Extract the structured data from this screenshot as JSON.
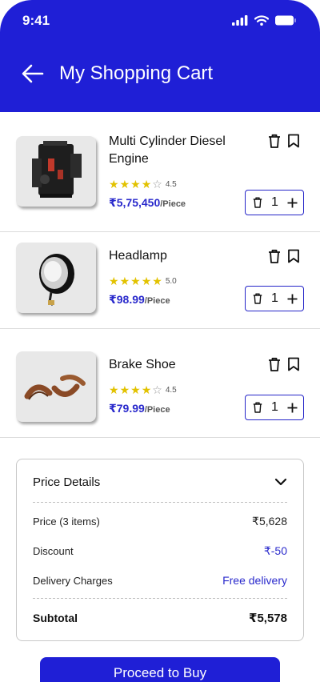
{
  "status_bar": {
    "time": "9:41"
  },
  "header": {
    "title": "My Shopping Cart"
  },
  "items": [
    {
      "name": "Multi Cylinder Diesel Engine",
      "rating": 4.5,
      "rating_label": "4.5",
      "price": "₹5,75,450",
      "unit": "/Piece",
      "quantity": "1",
      "image_icon": "engine-image"
    },
    {
      "name": "Headlamp",
      "rating": 5.0,
      "rating_label": "5.0",
      "price": "₹98.99",
      "unit": "/Piece",
      "quantity": "1",
      "image_icon": "headlamp-image"
    },
    {
      "name": "Brake Shoe",
      "rating": 4.5,
      "rating_label": "4.5",
      "price": "₹79.99",
      "unit": "/Piece",
      "quantity": "1",
      "image_icon": "brake-shoe-image"
    }
  ],
  "price_details": {
    "title": "Price Details",
    "price_label": "Price (3 items)",
    "price_value": "₹5,628",
    "discount_label": "Discount",
    "discount_value": "₹-50",
    "delivery_label": "Delivery Charges",
    "delivery_value": "Free delivery",
    "subtotal_label": "Subtotal",
    "subtotal_value": "₹5,578"
  },
  "cta": {
    "label": "Proceed to Buy"
  },
  "colors": {
    "brand": "#1f1fd6",
    "price": "#2a2acc",
    "star": "#e2c200"
  }
}
